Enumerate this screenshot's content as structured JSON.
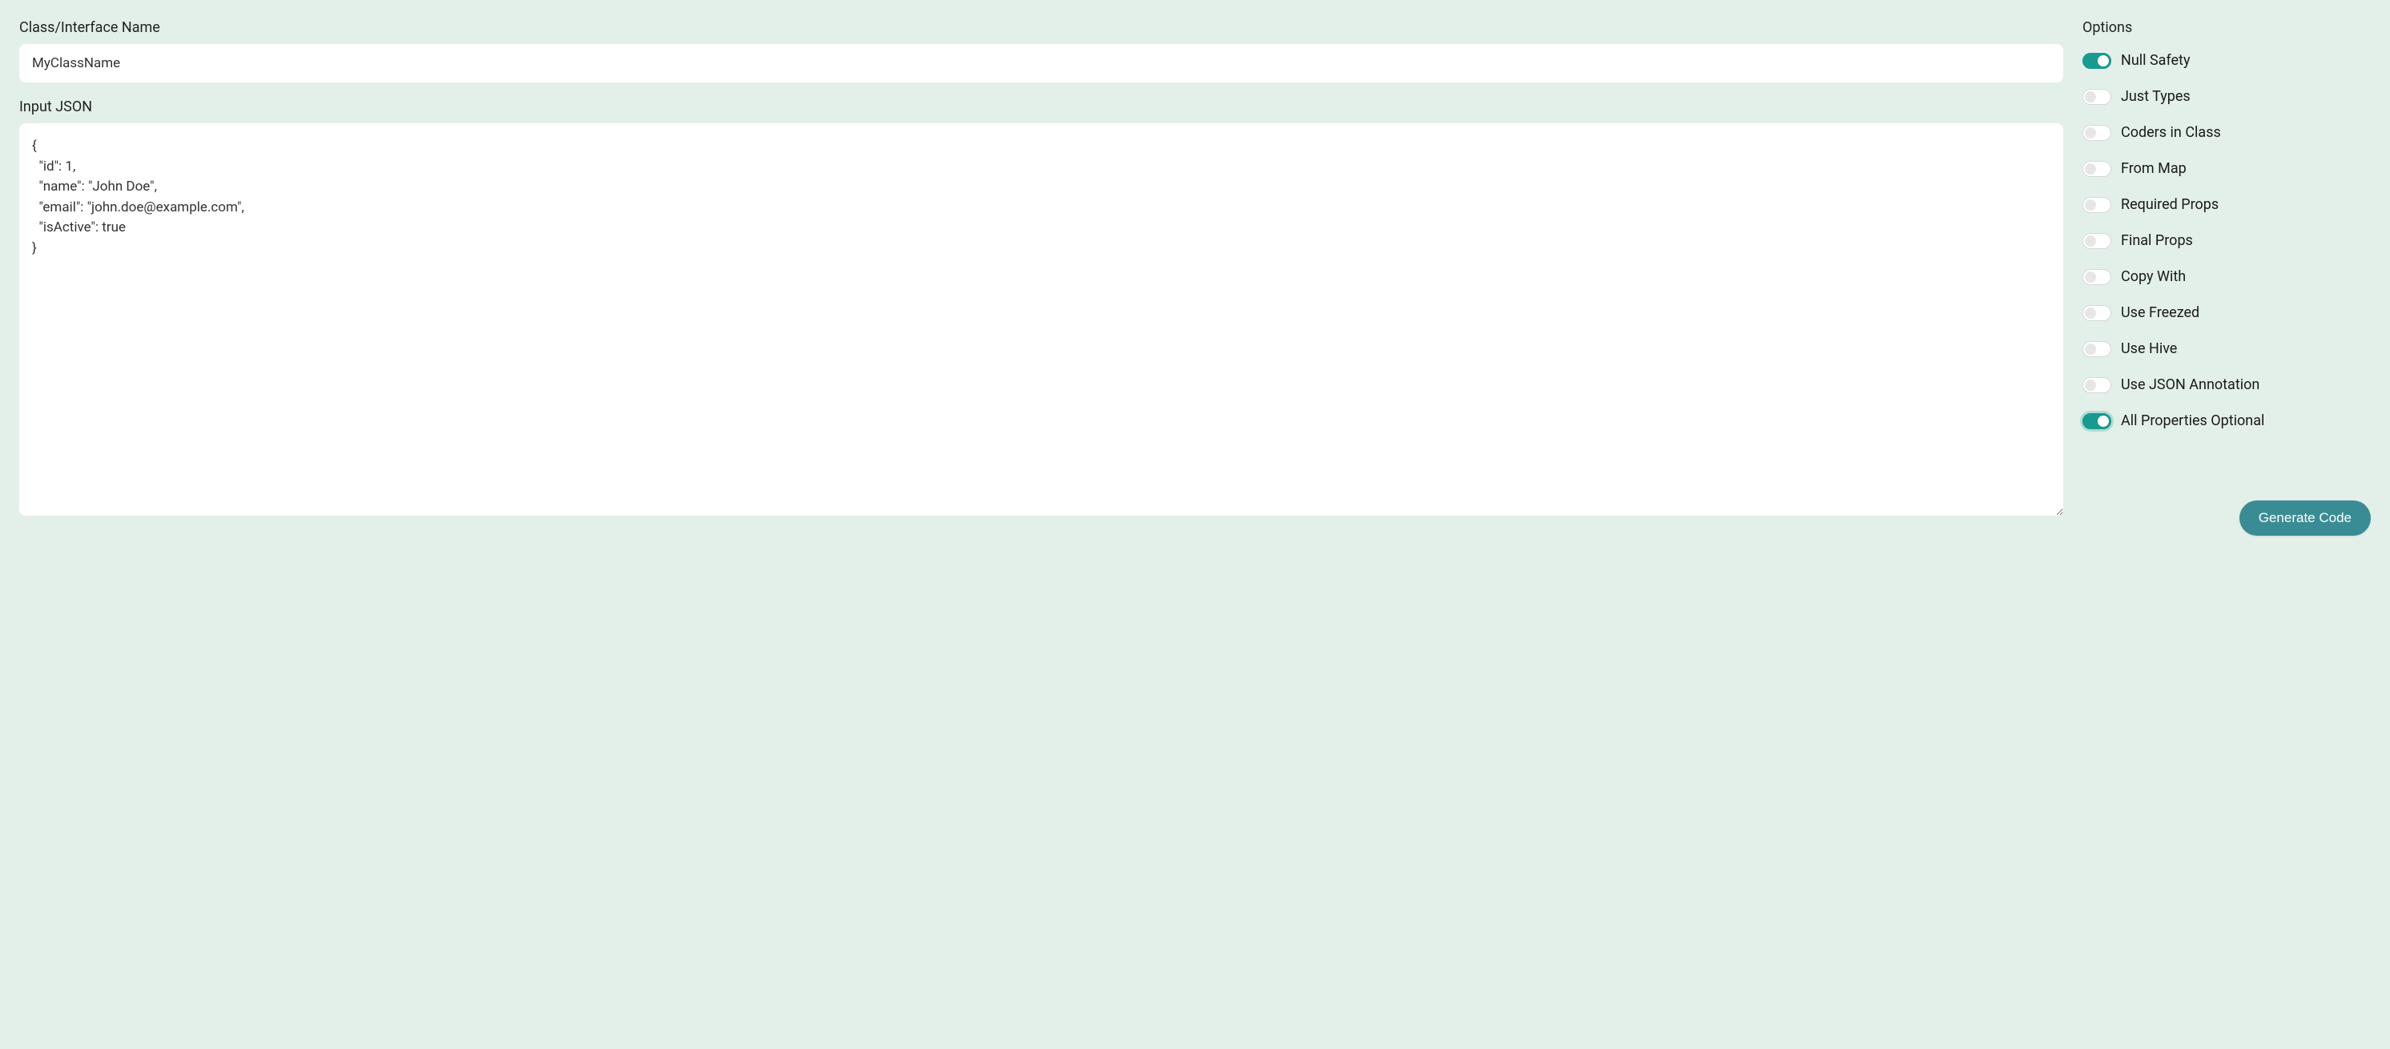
{
  "left": {
    "class_name_label": "Class/Interface Name",
    "class_name_value": "MyClassName",
    "input_json_label": "Input JSON",
    "input_json_value": "{\n  \"id\": 1,\n  \"name\": \"John Doe\",\n  \"email\": \"john.doe@example.com\",\n  \"isActive\": true\n}"
  },
  "options": {
    "title": "Options",
    "items": [
      {
        "key": "null-safety",
        "label": "Null Safety",
        "enabled": true,
        "focused": false
      },
      {
        "key": "just-types",
        "label": "Just Types",
        "enabled": false,
        "focused": false
      },
      {
        "key": "coders-in-class",
        "label": "Coders in Class",
        "enabled": false,
        "focused": false
      },
      {
        "key": "from-map",
        "label": "From Map",
        "enabled": false,
        "focused": false
      },
      {
        "key": "required-props",
        "label": "Required Props",
        "enabled": false,
        "focused": false
      },
      {
        "key": "final-props",
        "label": "Final Props",
        "enabled": false,
        "focused": false
      },
      {
        "key": "copy-with",
        "label": "Copy With",
        "enabled": false,
        "focused": false
      },
      {
        "key": "use-freezed",
        "label": "Use Freezed",
        "enabled": false,
        "focused": false
      },
      {
        "key": "use-hive",
        "label": "Use Hive",
        "enabled": false,
        "focused": false
      },
      {
        "key": "use-json-annotation",
        "label": "Use JSON Annotation",
        "enabled": false,
        "focused": false
      },
      {
        "key": "all-properties-optional",
        "label": "All Properties Optional",
        "enabled": true,
        "focused": true
      }
    ]
  },
  "actions": {
    "generate_label": "Generate Code"
  }
}
